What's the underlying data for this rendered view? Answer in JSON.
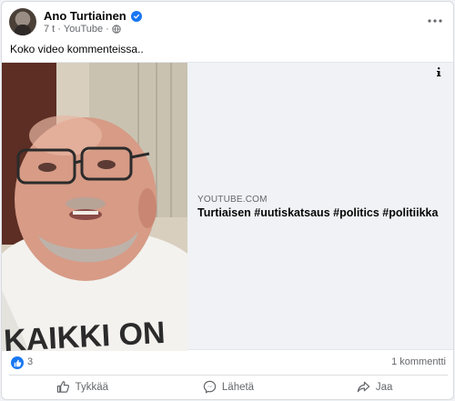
{
  "post": {
    "author": "Ano Turtiainen",
    "time": "7 t",
    "source": "YouTube",
    "separator": "·",
    "text": "Koko video kommenteissa.."
  },
  "link_preview": {
    "domain": "YOUTUBE.COM",
    "title": "Turtiaisen #uutiskatsaus #politics #politiikka",
    "info_label": "i"
  },
  "reactions": {
    "count": "3",
    "comments": "1 kommentti"
  },
  "actions": {
    "like": "Tykkää",
    "send": "Lähetä",
    "share": "Jaa"
  },
  "colors": {
    "accent": "#1877f2",
    "secondary_text": "#65676b"
  },
  "icons": [
    "verified-icon",
    "globe-icon",
    "more-icon",
    "info-icon",
    "like-badge-icon",
    "thumbs-up-icon",
    "messenger-icon",
    "share-icon"
  ]
}
